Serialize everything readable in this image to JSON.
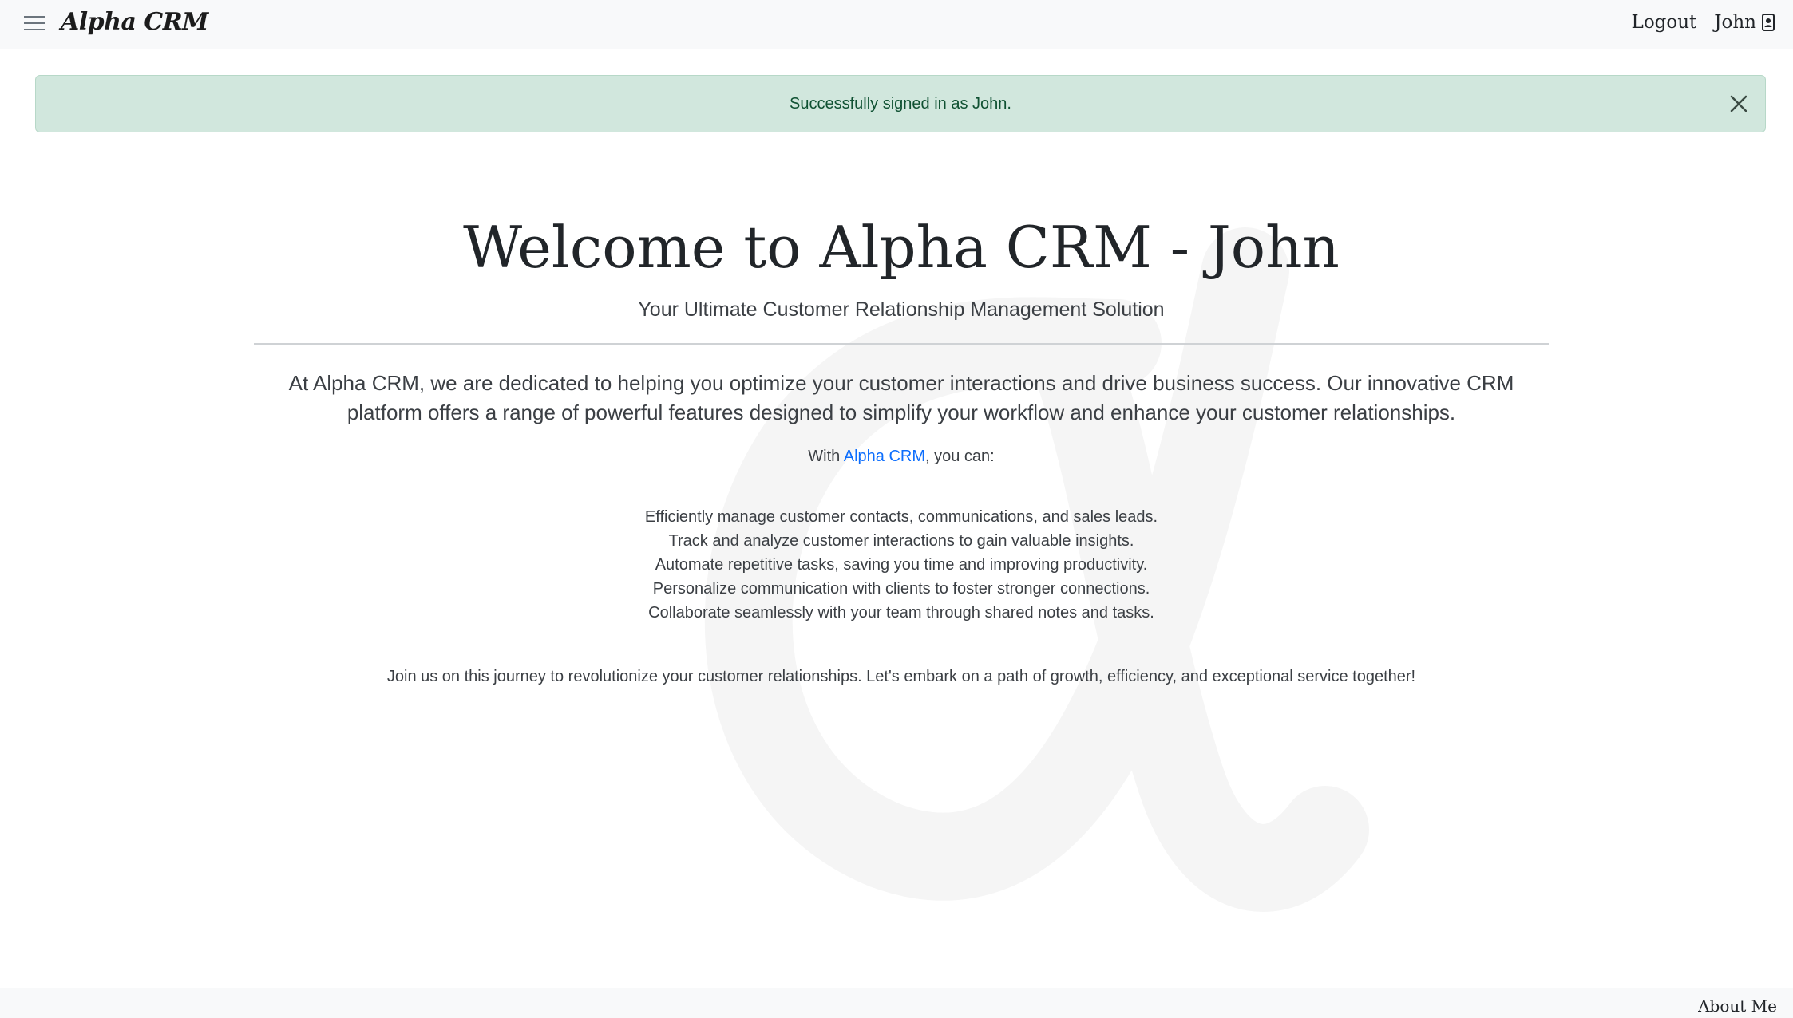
{
  "navbar": {
    "brand": "Alpha CRM",
    "logout": "Logout",
    "user": "John"
  },
  "alert": {
    "message": "Successfully signed in as John."
  },
  "main": {
    "title": "Welcome to Alpha CRM - John",
    "subtitle": "Your Ultimate Customer Relationship Management Solution",
    "intro": "At Alpha CRM, we are dedicated to helping you optimize your customer interactions and drive business success. Our innovative CRM platform offers a range of powerful features designed to simplify your workflow and enhance your customer relationships.",
    "with_prefix": "With ",
    "with_link": "Alpha CRM",
    "with_suffix": ", you can:",
    "features": [
      "Efficiently manage customer contacts, communications, and sales leads.",
      "Track and analyze customer interactions to gain valuable insights.",
      "Automate repetitive tasks, saving you time and improving productivity.",
      "Personalize communication with clients to foster stronger connections.",
      "Collaborate seamlessly with your team through shared notes and tasks."
    ],
    "closing": "Join us on this journey to revolutionize your customer relationships. Let's embark on a path of growth, efficiency, and exceptional service together!"
  },
  "footer": {
    "about": "About Me"
  },
  "icons": {
    "menu": "hamburger-menu-icon",
    "user": "user-badge-icon",
    "close": "close-icon",
    "watermark": "alpha-symbol"
  },
  "colors": {
    "navbar_bg": "#f8f9fa",
    "alert_bg": "#d1e7dd",
    "alert_text": "#0f5132",
    "link": "#0d6efd"
  }
}
